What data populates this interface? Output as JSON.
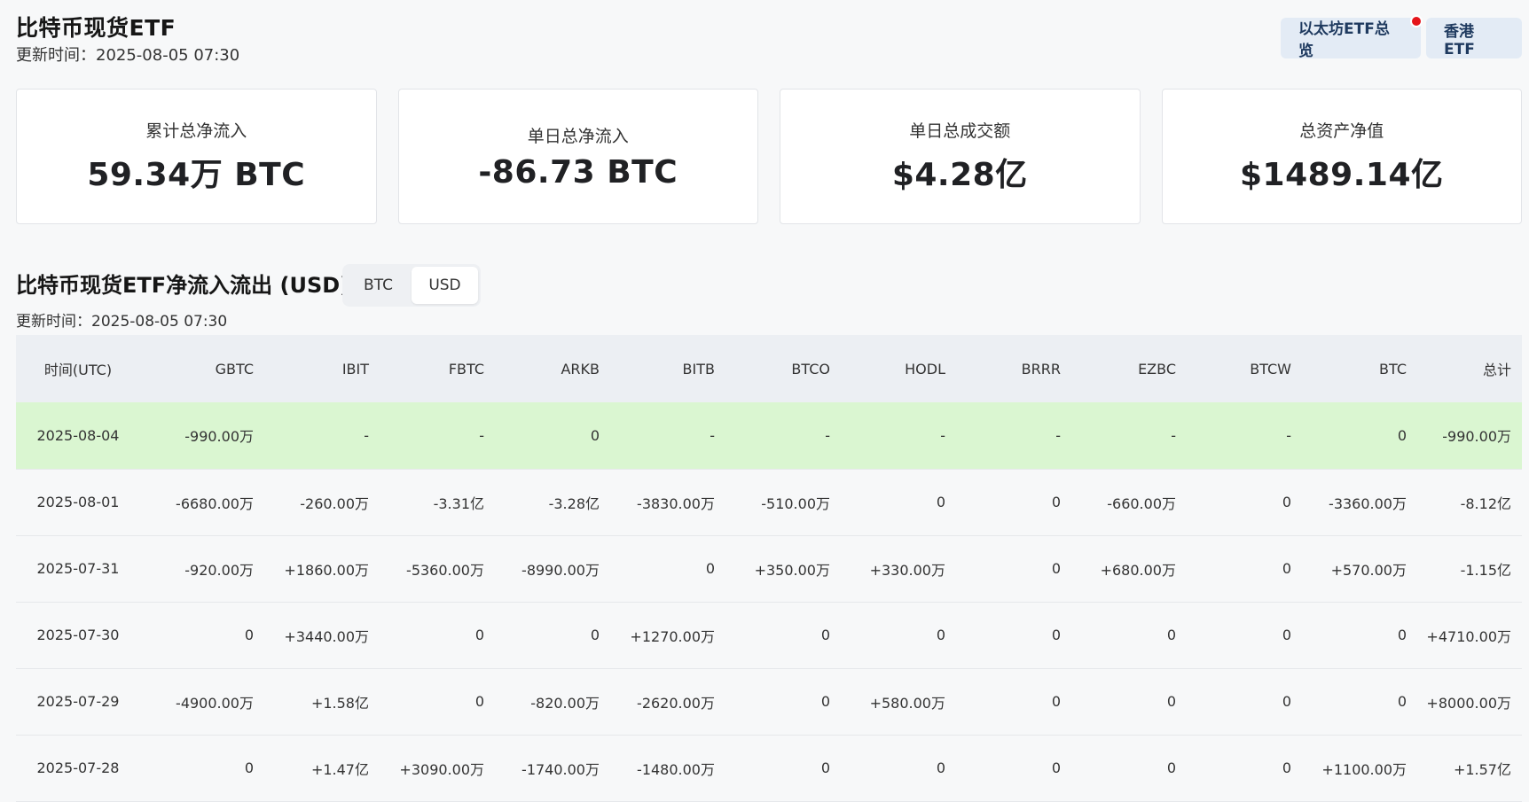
{
  "header": {
    "title": "比特币现货ETF",
    "updated": "更新时间：2025-08-05 07:30",
    "buttons": [
      "以太坊ETF总览",
      "香港 ETF"
    ]
  },
  "stats": [
    {
      "label": "累计总净流入",
      "value": "59.34万 BTC"
    },
    {
      "label": "单日总净流入",
      "value": "-86.73 BTC"
    },
    {
      "label": "单日总成交额",
      "value": "$4.28亿"
    },
    {
      "label": "总资产净值",
      "value": "$1489.14亿"
    }
  ],
  "section": {
    "title": "比特币现货ETF净流入流出 (USD)",
    "toggle": [
      "BTC",
      "USD"
    ],
    "active_toggle": "USD",
    "updated": "更新时间：2025-08-05 07:30"
  },
  "colors": {
    "positive": "#16a37c",
    "negative": "#e0384b",
    "highlight_row": "#daf6d1"
  },
  "table": {
    "headers": [
      "时间(UTC)",
      "GBTC",
      "IBIT",
      "FBTC",
      "ARKB",
      "BITB",
      "BTCO",
      "HODL",
      "BRRR",
      "EZBC",
      "BTCW",
      "BTC",
      "总计"
    ],
    "rows": [
      [
        "2025-08-04",
        "-990.00万",
        "-",
        "-",
        "0",
        "-",
        "-",
        "-",
        "-",
        "-",
        "-",
        "0",
        "-990.00万"
      ],
      [
        "2025-08-01",
        "-6680.00万",
        "-260.00万",
        "-3.31亿",
        "-3.28亿",
        "-3830.00万",
        "-510.00万",
        "0",
        "0",
        "-660.00万",
        "0",
        "-3360.00万",
        "-8.12亿"
      ],
      [
        "2025-07-31",
        "-920.00万",
        "+1860.00万",
        "-5360.00万",
        "-8990.00万",
        "0",
        "+350.00万",
        "+330.00万",
        "0",
        "+680.00万",
        "0",
        "+570.00万",
        "-1.15亿"
      ],
      [
        "2025-07-30",
        "0",
        "+3440.00万",
        "0",
        "0",
        "+1270.00万",
        "0",
        "0",
        "0",
        "0",
        "0",
        "0",
        "+4710.00万"
      ],
      [
        "2025-07-29",
        "-4900.00万",
        "+1.58亿",
        "0",
        "-820.00万",
        "-2620.00万",
        "0",
        "+580.00万",
        "0",
        "0",
        "0",
        "0",
        "+8000.00万"
      ],
      [
        "2025-07-28",
        "0",
        "+1.47亿",
        "+3090.00万",
        "-1740.00万",
        "-1480.00万",
        "0",
        "0",
        "0",
        "0",
        "0",
        "+1100.00万",
        "+1.57亿"
      ]
    ]
  }
}
